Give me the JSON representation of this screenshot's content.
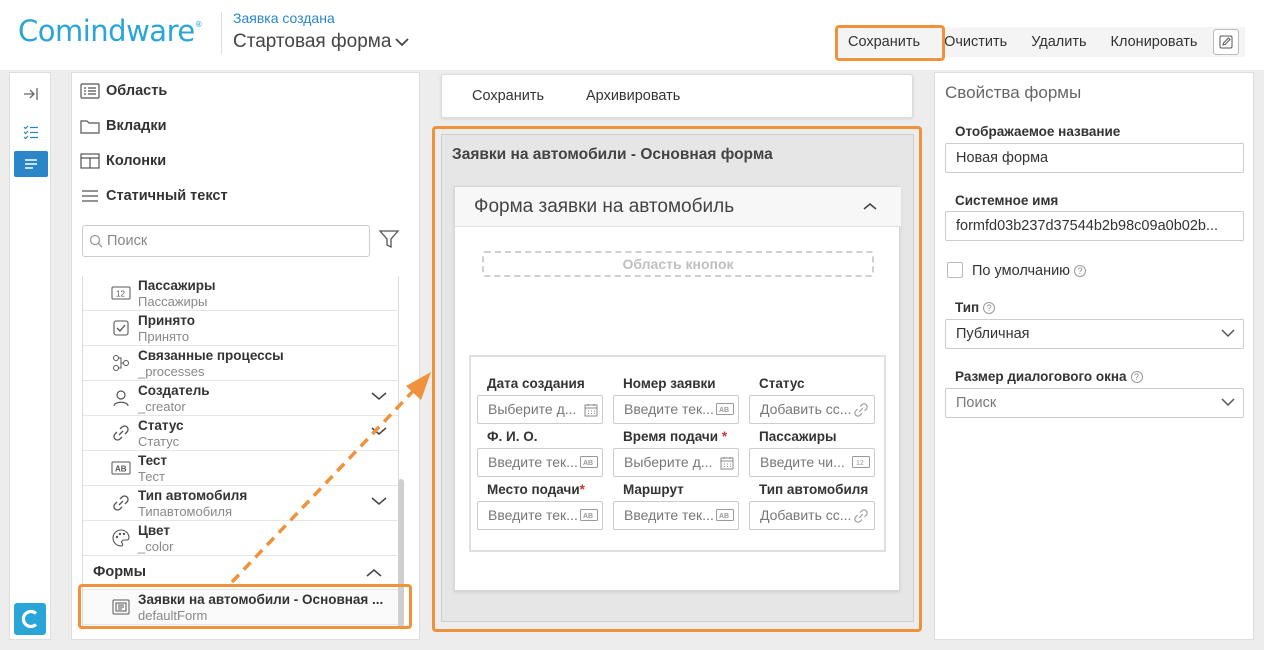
{
  "header": {
    "logo": "Comindware",
    "subtitle_link": "Заявка создана",
    "title": "Стартовая форма",
    "toolbar": {
      "save": "Сохранить",
      "clear": "Очистить",
      "delete": "Удалить",
      "clone": "Клонировать",
      "edit_icon": "pencil-icon"
    }
  },
  "palette": {
    "items": [
      {
        "label": "Область",
        "icon": "list-box-icon"
      },
      {
        "label": "Вкладки",
        "icon": "folder-icon"
      },
      {
        "label": "Колонки",
        "icon": "columns-icon"
      },
      {
        "label": "Статичный текст",
        "icon": "text-lines-icon"
      }
    ],
    "search_placeholder": "Поиск",
    "attributes": [
      {
        "title": "Пассажиры",
        "sub": "Пассажиры",
        "icon": "number-icon"
      },
      {
        "title": "Принято",
        "sub": "Принято",
        "icon": "checkbox-icon"
      },
      {
        "title": "Связанные процессы",
        "sub": "_processes",
        "icon": "process-icon"
      },
      {
        "title": "Создатель",
        "sub": "_creator",
        "icon": "user-icon"
      },
      {
        "title": "Статус",
        "sub": "Статус",
        "icon": "link-icon"
      },
      {
        "title": "Тест",
        "sub": "Тест",
        "icon": "text-ab-icon"
      },
      {
        "title": "Тип автомобиля",
        "sub": "Типавтомобиля",
        "icon": "link-icon"
      },
      {
        "title": "Цвет",
        "sub": "_color",
        "icon": "palette-icon"
      }
    ],
    "forms_header": "Формы",
    "forms": [
      {
        "title": "Заявки на автомобили - Основная ...",
        "sub": "defaultForm"
      }
    ]
  },
  "center": {
    "top_buttons": {
      "save": "Сохранить",
      "archive": "Архивировать"
    },
    "form_title": "Заявки на автомобили - Основная форма",
    "card_title": "Форма заявки на автомобиль",
    "button_area": "Область кнопок",
    "fields": [
      {
        "label": "Дата создания",
        "placeholder": "Выберите д...",
        "required": false
      },
      {
        "label": "Номер заявки",
        "placeholder": "Введите тек...",
        "required": false
      },
      {
        "label": "Статус",
        "placeholder": "Добавить сс...",
        "required": false
      },
      {
        "label": "Ф. И. О.",
        "placeholder": "Введите тек...",
        "required": false
      },
      {
        "label": "Время подачи",
        "placeholder": "Выберите д...",
        "required": true
      },
      {
        "label": "Пассажиры",
        "placeholder": "Введите чи...",
        "required": false
      },
      {
        "label": "Место подачи",
        "placeholder": "Введите тек...",
        "required": true
      },
      {
        "label": "Маршрут",
        "placeholder": "Введите тек...",
        "required": false
      },
      {
        "label": "Тип автомобиля",
        "placeholder": "Добавить сс...",
        "required": false
      }
    ],
    "required_mark": "*"
  },
  "properties": {
    "title": "Свойства формы",
    "display_name_label": "Отображаемое название",
    "display_name_value": "Новая форма",
    "system_name_label": "Системное имя",
    "system_name_value": "formfd03b237d37544b2b98c09a0b02b...",
    "default_label": "По умолчанию",
    "type_label": "Тип",
    "type_value": "Публичная",
    "dialog_size_label": "Размер диалогового окна",
    "dialog_size_value": "Поиск",
    "help_icon": "?"
  },
  "colors": {
    "accent": "#2a86c9",
    "logo": "#2aa5d8",
    "highlight": "#f0923b",
    "required": "#d03030"
  }
}
